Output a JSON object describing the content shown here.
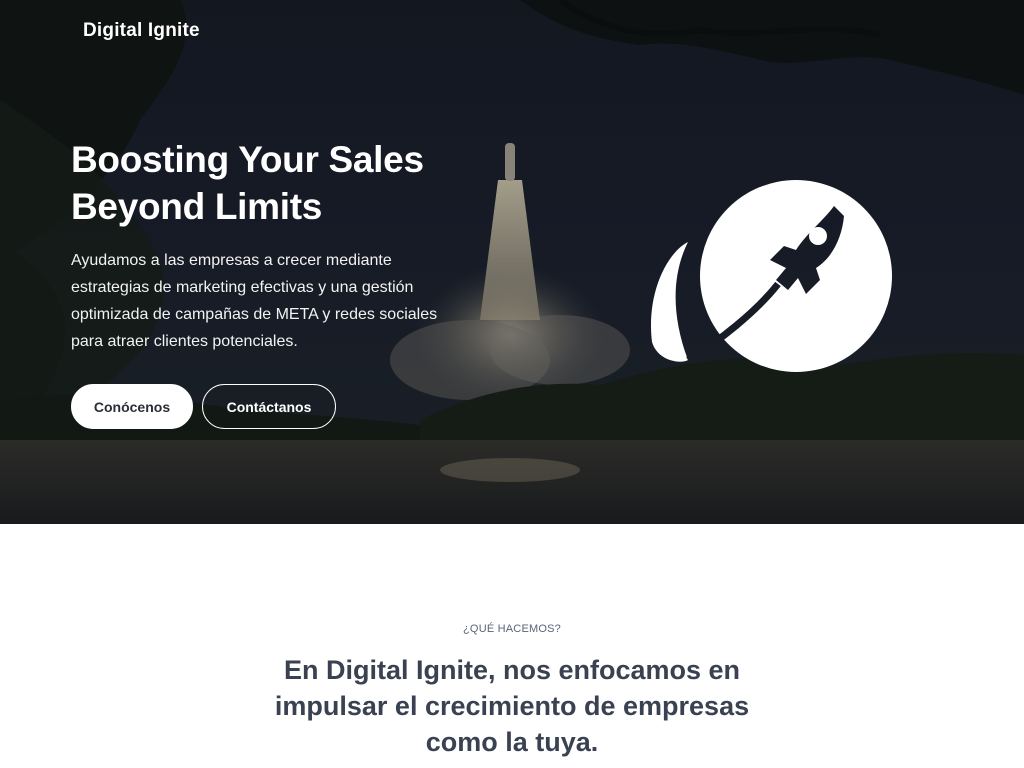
{
  "brand": {
    "name": "Digital Ignite"
  },
  "hero": {
    "title": "Boosting Your Sales Beyond Limits",
    "description": "Ayudamos a las empresas a crecer mediante estrategias de marketing efectivas y una gestión optimizada de campañas de META y redes sociales para atraer clientes potenciales.",
    "primary_button": "Conócenos",
    "secondary_button": "Contáctanos",
    "logo_icon": "rocket-orbit-icon",
    "background_image": "rocket-launch-at-night-photo"
  },
  "what_we_do": {
    "eyebrow": "¿QUÉ HACEMOS?",
    "heading": "En Digital Ignite, nos enfocamos en impulsar el crecimiento de empresas como la tuya."
  },
  "colors": {
    "hero_overlay": "#14181f",
    "button_primary_bg": "#ffffff",
    "button_primary_text": "#2b2e35",
    "heading_dark": "#3a4252",
    "eyebrow_text": "#5a6478"
  }
}
